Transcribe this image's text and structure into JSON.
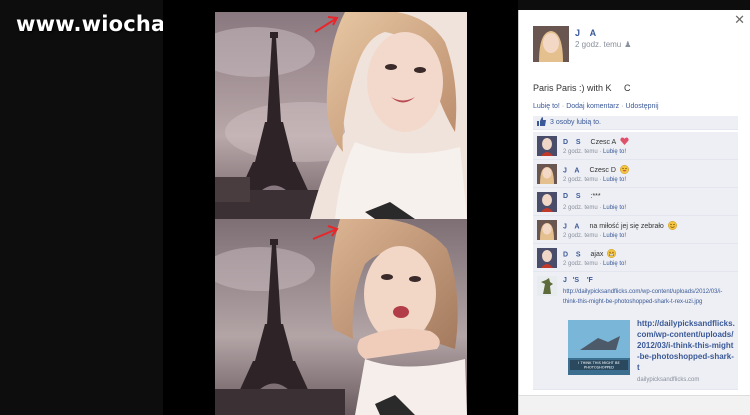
{
  "watermark": "www.wiocha.pl",
  "photos": {
    "arrow_color": "#e8262b"
  },
  "sidebar": {
    "close_symbol": "✕",
    "owner": {
      "name": "J    A",
      "time": "2 godz. temu",
      "privacy_icon": "friends-icon"
    },
    "caption": "Paris Paris :) with K     C",
    "actions": {
      "like": "Lubię to!",
      "comment": "Dodaj komentarz",
      "share": "Udostępnij",
      "separator": "·"
    },
    "likes": {
      "text": "3 osoby lubią to."
    },
    "comments": [
      {
        "author": "D    S",
        "text": "Czesc A",
        "emoji": "heart",
        "time": "2 godz. temu",
        "like": "Lubię to!"
      },
      {
        "author": "J    A",
        "text": "Czesc D",
        "emoji": "grin",
        "time": "2 godz. temu",
        "like": "Lubię to!"
      },
      {
        "author": "D    S",
        "text": ":***",
        "emoji": "",
        "time": "2 godz. temu",
        "like": "Lubię to!"
      },
      {
        "author": "J    A",
        "text": "na miłość jej się zebrało",
        "emoji": "smile",
        "time": "2 godz. temu",
        "like": "Lubię to!"
      },
      {
        "author": "D    S",
        "text": "ajax",
        "emoji": "teeth",
        "time": "2 godz. temu",
        "like": "Lubię to!"
      }
    ],
    "link_comment": {
      "author": "J   'S    'F",
      "url": "http://dailypicksandflicks.com/wp-content/uploads/2012/03/i-think-this-might-be-photoshopped-shark-t-rex-uzi.jpg",
      "preview_title": "http://dailypicksandflicks.com/wp-content/uploads/2012/03/i-think-this-might-be-photoshopped-shark-t",
      "preview_domain": "dailypicksandflicks.com",
      "thumb_caption": "I THINK THIS MIGHT BE PHOTOSHOPPED"
    }
  }
}
